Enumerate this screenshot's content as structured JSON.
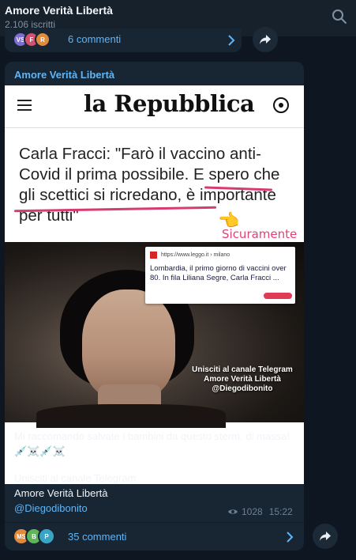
{
  "header": {
    "title": "Amore Verità Libertà",
    "subscribers": "2.106 iscritti",
    "search_icon": "search-icon"
  },
  "prev_post": {
    "avatars": [
      {
        "initials": "VS",
        "color": "#7c6fd1"
      },
      {
        "initials": "F",
        "color": "#d64f6e"
      },
      {
        "initials": "R",
        "color": "#e08a3c"
      }
    ],
    "comments": "6 commenti"
  },
  "post": {
    "channel": "Amore Verità Libertà",
    "image": {
      "masthead": "la Repubblica",
      "headline": "Carla Fracci: \"Farò il vaccino anti-Covid il prima possibile. E spero che gli scettici si ricredano, è importante per tutti\"",
      "annotation": "Sicuramente",
      "card_url": "https://www.leggo.it › milano",
      "card_title": "Lombardia, il primo giorno di vaccini over 80. In fila Liliana Segre, Carla Fracci ...",
      "overlay": "Unisciti al canale Telegram Amore Verità Libertà @Diegodibonito"
    },
    "text_line1": "Mi raccomando salvate i bambini da questo sterm. di massa! 💉☠️💉☠️",
    "text_line2": "Unisciti al canale Telegram",
    "text_line3": "Amore Verità Libertà",
    "text_link": "@Diegodibonito",
    "views": "1028",
    "time": "15:22",
    "avatars": [
      {
        "initials": "MS",
        "color": "#e08a3c"
      },
      {
        "initials": "B",
        "color": "#5fb55a"
      },
      {
        "initials": "P",
        "color": "#3aa4c4"
      }
    ],
    "comments": "35 commenti"
  },
  "colors": {
    "background": "#0e1621",
    "bubble": "#182533",
    "accent": "#5eb5f7"
  }
}
